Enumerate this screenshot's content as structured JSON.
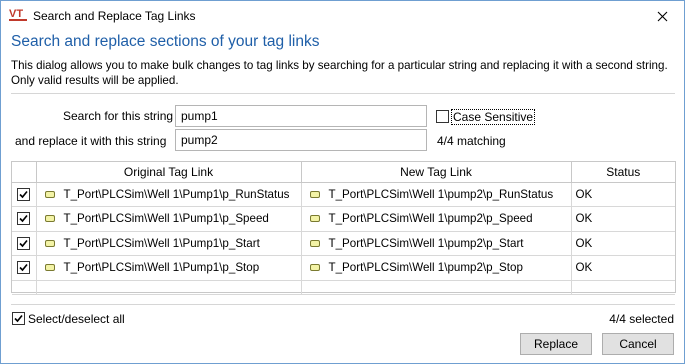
{
  "window": {
    "title": "Search and Replace Tag Links",
    "app_icon_text": "VT"
  },
  "heading": "Search and replace sections of your tag links",
  "description": "This dialog allows you to make bulk changes to tag links by searching for a particular string and replacing it with a second string. Only valid results will be applied.",
  "search": {
    "label": "Search for this string",
    "value": "pump1",
    "case_sensitive_label": "Case Sensitive",
    "case_sensitive_checked": false
  },
  "replace": {
    "label": "and replace it with this string",
    "value": "pump2",
    "matching_text": "4/4 matching"
  },
  "table": {
    "columns": [
      "",
      "Original Tag Link",
      "New Tag Link",
      "Status"
    ],
    "rows": [
      {
        "checked": true,
        "original": "T_Port\\PLCSim\\Well 1\\Pump1\\p_RunStatus",
        "new": "T_Port\\PLCSim\\Well 1\\pump2\\p_RunStatus",
        "status": "OK"
      },
      {
        "checked": true,
        "original": "T_Port\\PLCSim\\Well 1\\Pump1\\p_Speed",
        "new": "T_Port\\PLCSim\\Well 1\\pump2\\p_Speed",
        "status": "OK"
      },
      {
        "checked": true,
        "original": "T_Port\\PLCSim\\Well 1\\Pump1\\p_Start",
        "new": "T_Port\\PLCSim\\Well 1\\pump2\\p_Start",
        "status": "OK"
      },
      {
        "checked": true,
        "original": "T_Port\\PLCSim\\Well 1\\Pump1\\p_Stop",
        "new": "T_Port\\PLCSim\\Well 1\\pump2\\p_Stop",
        "status": "OK"
      }
    ]
  },
  "footer": {
    "select_all_label": "Select/deselect all",
    "select_all_checked": true,
    "selected_count": "4/4 selected",
    "replace_button": "Replace",
    "cancel_button": "Cancel"
  },
  "colors": {
    "heading": "#1f5fa8",
    "logo": "#c0392b",
    "window_border": "#6f9fd1"
  }
}
